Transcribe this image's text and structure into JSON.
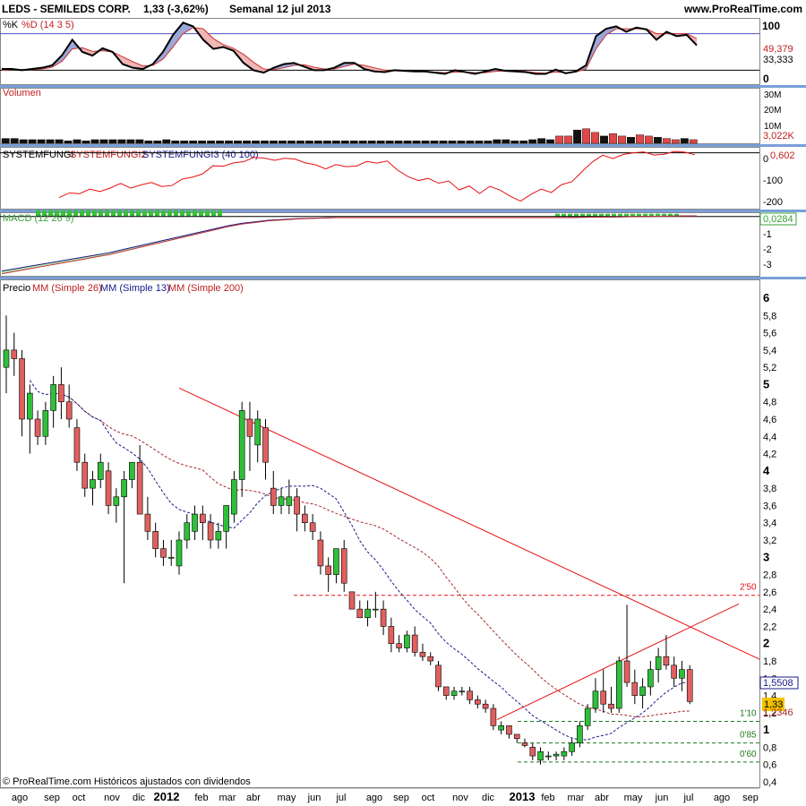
{
  "header": {
    "ticker": "LEDS - SEMILEDS CORP.",
    "price_change": "1,33 (-3,62%)",
    "period_date": "Semanal  12 jul 2013",
    "site": "www.ProRealTime.com"
  },
  "footer": "© ProRealTime.com Históricos ajustados con dividendos",
  "colors": {
    "up": "#2fbf3a",
    "down": "#e06060",
    "panel_border": "#7a9fd8",
    "ma26": "#a52a2a",
    "ma13": "#1a1a8a",
    "trend": "#e81010"
  },
  "chart_data": [
    {
      "id": "stochastic",
      "type": "line",
      "title": "%K %D (14 3 5)",
      "series_labels": [
        "%K",
        "%D (14 3 5)"
      ],
      "ylim": [
        0,
        100
      ],
      "yticks": [
        "100",
        "0"
      ],
      "levels": [
        20,
        80
      ],
      "last_values": [
        "49,379",
        "33,333"
      ],
      "series": [
        {
          "name": "%K",
          "values": [
            22,
            22,
            20,
            22,
            24,
            28,
            45,
            70,
            50,
            44,
            56,
            50,
            30,
            24,
            22,
            30,
            50,
            78,
            98,
            92,
            70,
            55,
            58,
            52,
            32,
            20,
            16,
            24,
            30,
            32,
            26,
            20,
            20,
            24,
            32,
            32,
            22,
            18,
            17,
            20,
            19,
            18,
            18,
            16,
            14,
            20,
            17,
            14,
            18,
            22,
            19,
            18,
            17,
            14,
            14,
            21,
            15,
            18,
            28,
            76,
            88,
            92,
            83,
            90,
            87,
            70,
            83,
            76,
            78,
            61
          ]
        },
        {
          "name": "%D",
          "values": [
            20,
            21,
            21,
            21,
            22,
            25,
            35,
            55,
            57,
            51,
            52,
            50,
            42,
            34,
            27,
            28,
            38,
            58,
            80,
            90,
            88,
            72,
            62,
            56,
            46,
            33,
            22,
            21,
            24,
            28,
            29,
            25,
            22,
            22,
            26,
            30,
            28,
            24,
            20,
            19,
            19,
            18,
            18,
            17,
            16,
            17,
            17,
            16,
            16,
            18,
            19,
            19,
            18,
            16,
            15,
            17,
            16,
            17,
            22,
            55,
            78,
            88,
            88,
            88,
            88,
            80,
            80,
            80,
            80,
            72
          ]
        }
      ]
    },
    {
      "id": "volume",
      "type": "bar",
      "title": "Volumen",
      "yticks": [
        "30M",
        "20M",
        "10M"
      ],
      "last_value": "3,022K",
      "values": [
        4,
        4,
        3,
        3,
        3,
        3,
        3,
        2,
        3,
        2,
        3,
        3,
        3,
        3,
        3,
        3,
        2,
        2,
        3,
        2,
        2,
        2,
        2,
        2,
        2,
        2,
        2,
        2,
        2,
        2,
        2,
        2,
        2,
        2,
        2,
        2,
        2,
        2,
        2,
        2,
        2,
        2,
        2,
        2,
        2,
        2,
        2,
        2,
        2,
        2,
        2,
        2,
        2,
        2,
        2,
        3,
        3,
        2,
        2,
        3,
        4,
        3,
        6,
        6,
        11,
        12,
        9,
        6,
        8,
        6,
        5,
        7,
        6,
        5,
        4,
        3,
        4,
        3
      ]
    },
    {
      "id": "systemfungi",
      "type": "line",
      "title": "SYSTEMFUNGI SYSTEMFUNGI2 SYSTEMFUNGI3 (40 100)",
      "series_labels": [
        "SYSTEMFUNGI",
        "SYSTEMFUNGI2",
        "SYSTEMFUNGI3 (40 100)"
      ],
      "yticks": [
        "0",
        "-100",
        "-200"
      ],
      "ylim": [
        -230,
        10
      ],
      "last_value": "0,602",
      "values": [
        -187,
        -168,
        -171,
        -152,
        -162,
        -147,
        -128,
        -148,
        -134,
        -124,
        -141,
        -137,
        -110,
        -102,
        -88,
        -54,
        -56,
        -42,
        -37,
        -19,
        -22,
        -31,
        -23,
        -26,
        -42,
        -50,
        -67,
        -49,
        -58,
        -55,
        -36,
        -43,
        -34,
        -72,
        -99,
        -116,
        -107,
        -127,
        -118,
        -155,
        -139,
        -170,
        -140,
        -156,
        -182,
        -202,
        -174,
        -152,
        -166,
        -133,
        -121,
        -78,
        -38,
        -10,
        -24,
        -7,
        0,
        4,
        -9,
        -6,
        6,
        3,
        -8
      ]
    },
    {
      "id": "macd",
      "type": "line",
      "title": "MACD (12 26 9)",
      "yticks": [
        "-1",
        "-2",
        "-3"
      ],
      "ylim": [
        -3.8,
        0.1
      ],
      "last_value": "0,0284",
      "values": [
        -3.6,
        -3.45,
        -3.3,
        -3.15,
        -3.0,
        -2.85,
        -2.7,
        -2.55,
        -2.4,
        -2.2,
        -2.0,
        -1.8,
        -1.6,
        -1.4,
        -1.2,
        -1.0,
        -0.8,
        -0.6,
        -0.45,
        -0.35,
        -0.25,
        -0.2,
        -0.15,
        -0.12,
        -0.1,
        -0.08,
        -0.08,
        -0.08,
        -0.08,
        -0.08,
        -0.08,
        -0.08,
        -0.08,
        -0.08,
        -0.08,
        -0.08,
        -0.08,
        -0.08,
        -0.08,
        -0.08,
        -0.08,
        -0.08,
        -0.08,
        -0.06,
        -0.05,
        -0.04,
        -0.03,
        -0.02,
        0.0,
        0.01,
        0.02,
        0.03,
        0.03
      ]
    },
    {
      "id": "price",
      "type": "candlestick",
      "title": "Precio MM (Simple 26) MM (Simple 13) MM (Simple 200)",
      "series_labels": [
        "Precio",
        "MM (Simple 26)",
        "MM (Simple 13)",
        "MM (Simple 200)"
      ],
      "ylim": [
        0.4,
        6.2
      ],
      "yticks": [
        "6",
        "5,8",
        "5,6",
        "5,4",
        "5,2",
        "5",
        "4,8",
        "4,6",
        "4,4",
        "4,2",
        "4",
        "3,8",
        "3,6",
        "3,4",
        "3,2",
        "3",
        "2,8",
        "2,6",
        "2,4",
        "2,2",
        "2",
        "1,8",
        "1,6",
        "1,4",
        "1,2",
        "1",
        "0,8",
        "0,6",
        "0,4"
      ],
      "last_values": [
        "1,5508",
        "1,33",
        "1,2346"
      ],
      "levels": [
        {
          "label": "2'50",
          "value": 2.56
        },
        {
          "label": "1'10",
          "value": 1.1
        },
        {
          "label": "0'85",
          "value": 0.85
        },
        {
          "label": "0'60",
          "value": 0.63
        }
      ],
      "x_labels": [
        "ago",
        "sep",
        "oct",
        "nov",
        "dic",
        "2012",
        "feb",
        "mar",
        "abr",
        "may",
        "jun",
        "jul",
        "ago",
        "sep",
        "oct",
        "nov",
        "dic",
        "2013",
        "feb",
        "mar",
        "abr",
        "may",
        "jun",
        "jul",
        "ago",
        "sep"
      ],
      "ohlc": [
        [
          5.2,
          5.8,
          4.9,
          5.4
        ],
        [
          5.4,
          5.6,
          5.1,
          5.3
        ],
        [
          5.3,
          5.4,
          4.4,
          4.6
        ],
        [
          4.6,
          5.0,
          4.2,
          4.9
        ],
        [
          4.6,
          4.7,
          4.3,
          4.4
        ],
        [
          4.4,
          4.8,
          4.3,
          4.7
        ],
        [
          4.7,
          5.1,
          4.5,
          5.0
        ],
        [
          5.0,
          5.2,
          4.6,
          4.8
        ],
        [
          4.8,
          5.0,
          4.5,
          4.6
        ],
        [
          4.5,
          4.6,
          4.0,
          4.1
        ],
        [
          4.1,
          4.2,
          3.7,
          3.8
        ],
        [
          3.8,
          4.0,
          3.6,
          3.9
        ],
        [
          3.9,
          4.2,
          3.8,
          4.1
        ],
        [
          4.0,
          4.1,
          3.5,
          3.6
        ],
        [
          3.6,
          3.8,
          3.4,
          3.7
        ],
        [
          3.7,
          4.0,
          2.7,
          3.9
        ],
        [
          3.9,
          4.0,
          3.8,
          4.1
        ],
        [
          4.1,
          4.3,
          3.5,
          3.5
        ],
        [
          3.5,
          3.7,
          3.2,
          3.3
        ],
        [
          3.3,
          3.4,
          3.0,
          3.1
        ],
        [
          3.1,
          3.2,
          2.9,
          3.0
        ],
        [
          3.0,
          3.2,
          2.9,
          3.0
        ],
        [
          2.9,
          3.3,
          2.8,
          3.2
        ],
        [
          3.2,
          3.5,
          3.1,
          3.4
        ],
        [
          3.3,
          3.6,
          3.2,
          3.5
        ],
        [
          3.5,
          3.6,
          3.2,
          3.4
        ],
        [
          3.4,
          3.5,
          3.1,
          3.2
        ],
        [
          3.2,
          3.4,
          3.1,
          3.3
        ],
        [
          3.3,
          3.6,
          3.1,
          3.6
        ],
        [
          3.5,
          4.0,
          3.4,
          3.9
        ],
        [
          3.9,
          4.8,
          3.7,
          4.7
        ],
        [
          4.6,
          4.8,
          4.0,
          4.4
        ],
        [
          4.3,
          4.7,
          4.1,
          4.6
        ],
        [
          4.5,
          4.6,
          3.9,
          4.1
        ],
        [
          3.8,
          4.0,
          3.5,
          3.6
        ],
        [
          3.6,
          3.8,
          3.5,
          3.7
        ],
        [
          3.6,
          3.9,
          3.5,
          3.7
        ],
        [
          3.7,
          3.8,
          3.3,
          3.5
        ],
        [
          3.5,
          3.6,
          3.3,
          3.4
        ],
        [
          3.4,
          3.5,
          3.2,
          3.3
        ],
        [
          3.2,
          3.3,
          2.8,
          2.9
        ],
        [
          2.9,
          3.0,
          2.6,
          2.8
        ],
        [
          2.8,
          3.1,
          2.7,
          3.1
        ],
        [
          3.1,
          3.2,
          2.6,
          2.7
        ],
        [
          2.6,
          2.6,
          2.4,
          2.4
        ],
        [
          2.4,
          2.5,
          2.3,
          2.3
        ],
        [
          2.3,
          2.5,
          2.2,
          2.4
        ],
        [
          2.4,
          2.6,
          2.3,
          2.4
        ],
        [
          2.4,
          2.5,
          2.1,
          2.2
        ],
        [
          2.2,
          2.3,
          1.9,
          2.0
        ],
        [
          2.0,
          2.1,
          1.9,
          1.95
        ],
        [
          1.95,
          2.15,
          1.9,
          2.1
        ],
        [
          2.1,
          2.2,
          1.85,
          1.9
        ],
        [
          1.9,
          2.0,
          1.8,
          1.85
        ],
        [
          1.85,
          1.9,
          1.75,
          1.8
        ],
        [
          1.75,
          1.8,
          1.45,
          1.5
        ],
        [
          1.5,
          1.5,
          1.35,
          1.4
        ],
        [
          1.4,
          1.5,
          1.35,
          1.45
        ],
        [
          1.45,
          1.5,
          1.4,
          1.45
        ],
        [
          1.45,
          1.5,
          1.3,
          1.35
        ],
        [
          1.35,
          1.4,
          1.25,
          1.3
        ],
        [
          1.3,
          1.35,
          1.2,
          1.25
        ],
        [
          1.25,
          1.3,
          1.0,
          1.05
        ],
        [
          1.0,
          1.1,
          0.95,
          1.05
        ],
        [
          1.05,
          1.05,
          0.9,
          0.95
        ],
        [
          0.95,
          0.95,
          0.85,
          0.9
        ],
        [
          0.85,
          0.9,
          0.8,
          0.82
        ],
        [
          0.8,
          0.85,
          0.65,
          0.7
        ],
        [
          0.65,
          0.8,
          0.6,
          0.75
        ],
        [
          0.7,
          0.75,
          0.65,
          0.7
        ],
        [
          0.7,
          0.75,
          0.65,
          0.72
        ],
        [
          0.7,
          0.8,
          0.65,
          0.75
        ],
        [
          0.75,
          0.9,
          0.7,
          0.85
        ],
        [
          0.85,
          1.1,
          0.8,
          1.05
        ],
        [
          1.05,
          1.3,
          1.0,
          1.25
        ],
        [
          1.25,
          1.6,
          1.2,
          1.45
        ],
        [
          1.45,
          1.7,
          1.2,
          1.3
        ],
        [
          1.3,
          1.5,
          1.2,
          1.25
        ],
        [
          1.25,
          1.85,
          1.2,
          1.8
        ],
        [
          1.8,
          2.45,
          1.5,
          1.55
        ],
        [
          1.55,
          1.7,
          1.3,
          1.4
        ],
        [
          1.4,
          1.6,
          1.25,
          1.5
        ],
        [
          1.5,
          1.8,
          1.4,
          1.7
        ],
        [
          1.7,
          1.95,
          1.55,
          1.85
        ],
        [
          1.85,
          2.1,
          1.7,
          1.75
        ],
        [
          1.75,
          1.85,
          1.5,
          1.6
        ],
        [
          1.6,
          1.8,
          1.45,
          1.7
        ],
        [
          1.7,
          1.75,
          1.3,
          1.33
        ]
      ]
    }
  ]
}
